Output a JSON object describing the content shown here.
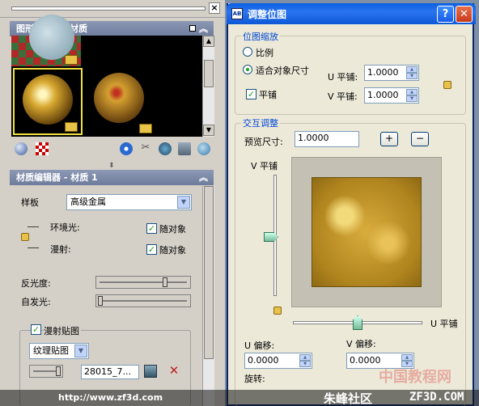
{
  "left_panel": {
    "available_materials": {
      "title": "图形中可用的材质"
    },
    "material_editor": {
      "title": "材质编辑器 - 材质 1",
      "template_label": "样板",
      "template_value": "高级金属",
      "ambient_label": "环境光:",
      "diffuse_label": "漫射:",
      "by_object_1": "随对象",
      "by_object_2": "随对象",
      "reflectivity_label": "反光度:",
      "reflectivity_value": 0.75,
      "self_illum_label": "自发光:",
      "self_illum_value": 0.0,
      "diffuse_map_label": "漫射贴图",
      "map_type_value": "纹理贴图",
      "map_strength_value": 1.0,
      "map_file_value": "28015_7..."
    }
  },
  "dialog": {
    "title": "调整位图",
    "help_label": "?",
    "close_label": "✕",
    "bitmap_scale": {
      "legend": "位图缩放",
      "option_ratio": "比例",
      "option_fit": "适合对象尺寸",
      "u_tile_label": "U 平铺:",
      "u_tile_value": "1.0000",
      "tile_label": "平铺",
      "v_tile_label": "V 平铺:",
      "v_tile_value": "1.0000"
    },
    "interactive": {
      "legend": "交互调整",
      "preview_size_label": "预览尺寸:",
      "preview_size_value": "1.0000",
      "plus_label": "+",
      "minus_label": "−",
      "v_tile_axis_label": "V 平铺",
      "u_tile_axis_label": "U 平铺",
      "u_offset_label": "U 偏移:",
      "u_offset_value": "0.0000",
      "v_offset_label": "V 偏移:",
      "v_offset_value": "0.0000",
      "rotation_label": "旋转:"
    }
  },
  "watermark": {
    "url": "http://www.zf3d.com",
    "community": "朱峰社区",
    "site": "ZF3D.COM",
    "tutorial": "中国教程网"
  },
  "colors": {
    "titlebar": "#0a5fe0",
    "dialog_bg": "#ece9d8",
    "panel_bg": "#d4d0c8",
    "rollout_header": "#8c98b4",
    "legend_blue": "#0046d5"
  }
}
